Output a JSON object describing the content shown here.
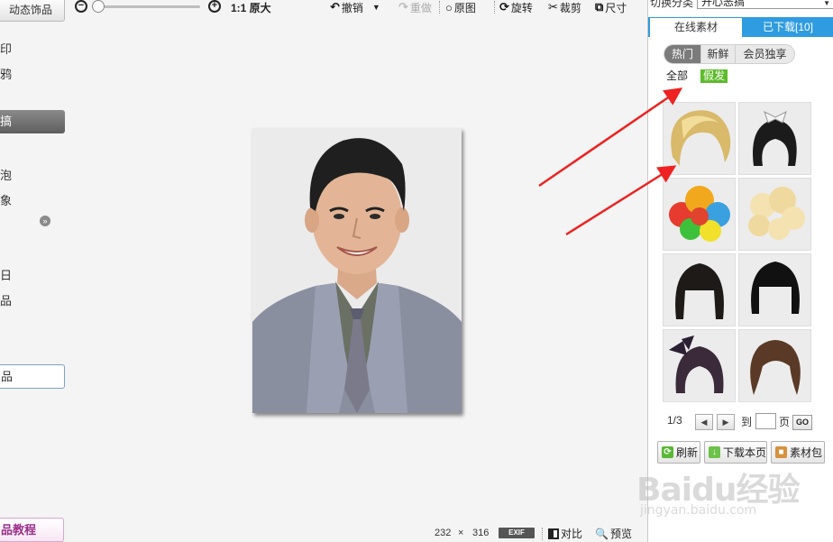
{
  "left_panel": {
    "top_button": "动态饰品",
    "items": [
      "印",
      "鸦",
      "泡",
      "象",
      "日",
      "品"
    ],
    "selected_item": "搞",
    "outlined_item": "品",
    "tutorial_button": "品教程"
  },
  "toolbar": {
    "actual_size": "1:1 原大",
    "undo": "撤销",
    "redo": "重做",
    "original": "原图",
    "rotate": "旋转",
    "crop": "裁剪",
    "size": "尺寸"
  },
  "status": {
    "width": "232",
    "times": "×",
    "height": "316",
    "exif": "EXIF",
    "compare": "对比",
    "preview": "预览"
  },
  "right_panel": {
    "category_label": "切换分类",
    "category_value": "开心恶搞",
    "tabs": [
      "在线素材",
      "已下载[10]"
    ],
    "subtabs": [
      "热门",
      "新鲜",
      "会员独享"
    ],
    "filters": [
      "全部",
      "假发"
    ],
    "pager": {
      "current": "1/3",
      "goto_label": "到",
      "page_label": "页",
      "go": "GO"
    },
    "actions": [
      "刷新",
      "下载本页",
      "素材包"
    ]
  },
  "hair_items": [
    "blonde-short-wig-icon",
    "black-bob-with-bow-icon",
    "rainbow-afro-wig-icon",
    "blonde-curly-wig-icon",
    "black-bob-bangs-icon",
    "black-hime-cut-icon",
    "black-bow-bob-icon",
    "brown-wavy-wig-icon"
  ],
  "watermark": {
    "logo": "Baidu经验",
    "url": "jingyan.baidu.com"
  },
  "colors": {
    "tab_blue": "#2f9be0",
    "filter_green": "#5dbb2a",
    "arrow_red": "#ee2222",
    "tutorial_purple": "#9b2f8a"
  }
}
